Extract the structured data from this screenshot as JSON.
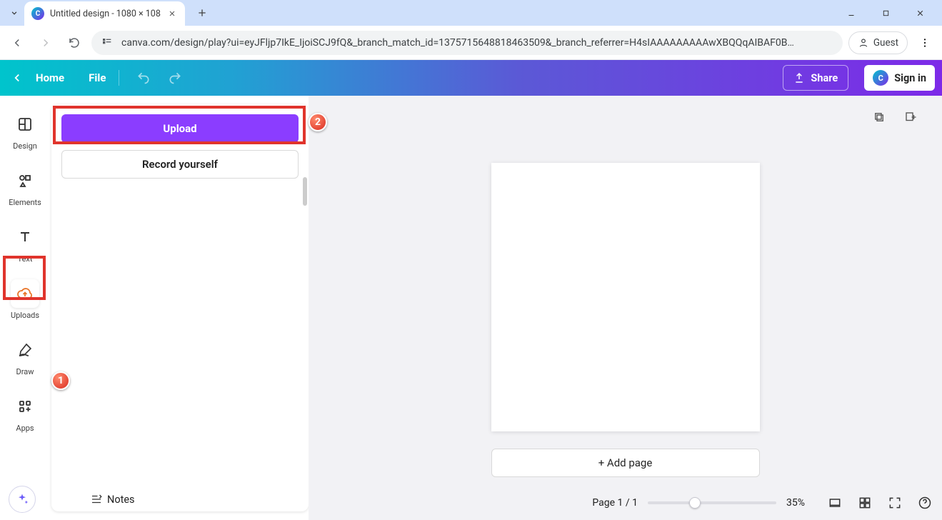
{
  "browser": {
    "tab_title": "Untitled design - 1080 × 108",
    "url": "canva.com/design/play?ui=eyJFljp7IkE_IjoiSCJ9fQ&_branch_match_id=1375715648818463509&_branch_referrer=H4sIAAAAAAAAAwXBQQqAIBAF0B…",
    "guest_label": "Guest"
  },
  "appbar": {
    "home": "Home",
    "file": "File",
    "share": "Share",
    "signin": "Sign in"
  },
  "rail": {
    "items": [
      {
        "label": "Design",
        "icon": "layout-icon"
      },
      {
        "label": "Elements",
        "icon": "shapes-icon"
      },
      {
        "label": "Text",
        "icon": "text-icon"
      },
      {
        "label": "Uploads",
        "icon": "cloud-up-icon"
      },
      {
        "label": "Draw",
        "icon": "draw-icon"
      },
      {
        "label": "Apps",
        "icon": "apps-icon"
      }
    ]
  },
  "panel": {
    "upload": "Upload",
    "record": "Record yourself"
  },
  "canvas": {
    "add_page": "+ Add page"
  },
  "footer": {
    "notes": "Notes",
    "page_counter": "Page 1 / 1",
    "zoom": "35%",
    "zoom_value": 35
  },
  "callouts": {
    "one": "1",
    "two": "2"
  }
}
